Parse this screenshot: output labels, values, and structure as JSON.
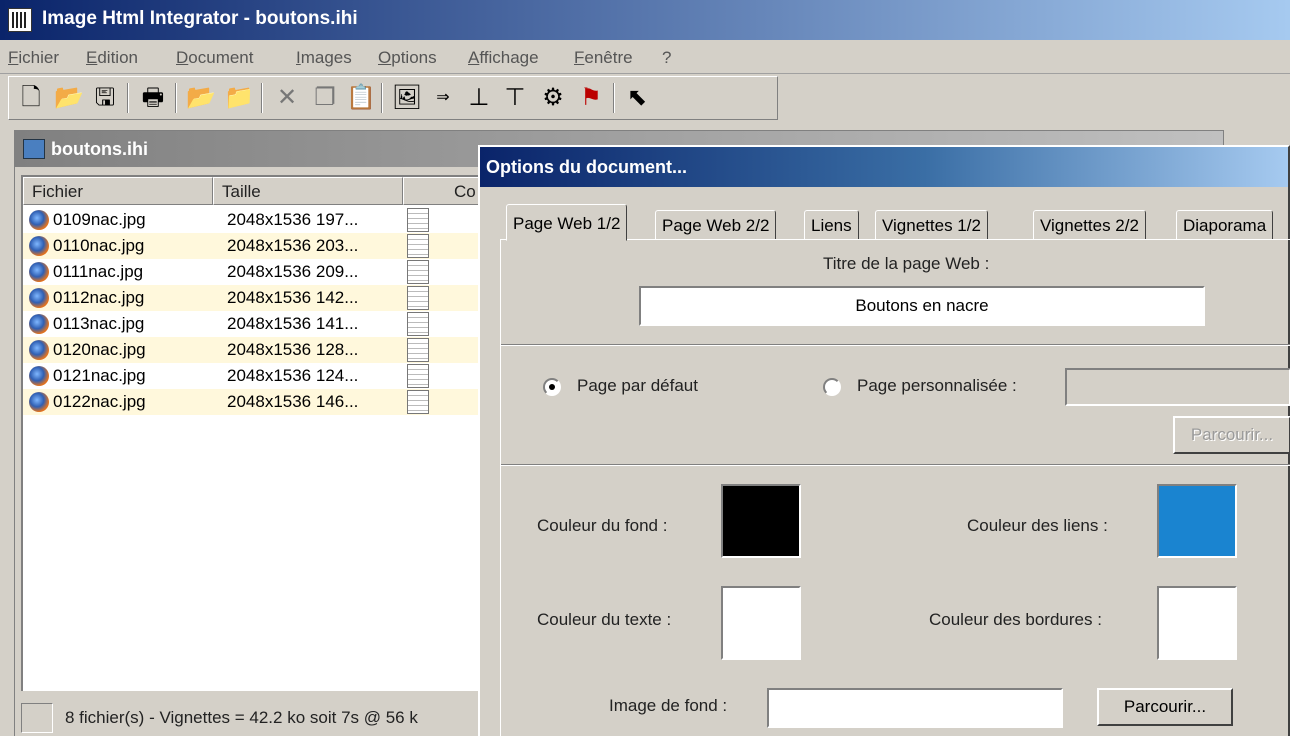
{
  "window": {
    "title": "Image Html Integrator - boutons.ihi"
  },
  "menu": [
    "Fichier",
    "Edition",
    "Document",
    "Images",
    "Options",
    "Affichage",
    "Fenêtre",
    "?"
  ],
  "toolbar": {
    "icons": [
      "new-file-icon",
      "open-folder-icon",
      "save-icon",
      "print-icon",
      "open-images-icon",
      "folder-new-icon",
      "cut-icon",
      "copy-icon",
      "paste-icon",
      "insert-image-icon",
      "move-image-icon",
      "move-up-icon",
      "move-down-icon",
      "generate-icon",
      "publish-web-icon",
      "back-icon"
    ]
  },
  "child_window": {
    "title": "boutons.ihi",
    "columns": [
      "Fichier",
      "Taille",
      "Co"
    ],
    "files": [
      {
        "name": "0109nac.jpg",
        "size": "2048x1536  197..."
      },
      {
        "name": "0110nac.jpg",
        "size": "2048x1536  203..."
      },
      {
        "name": "0111nac.jpg",
        "size": "2048x1536  209..."
      },
      {
        "name": "0112nac.jpg",
        "size": "2048x1536  142..."
      },
      {
        "name": "0113nac.jpg",
        "size": "2048x1536  141..."
      },
      {
        "name": "0120nac.jpg",
        "size": "2048x1536  128..."
      },
      {
        "name": "0121nac.jpg",
        "size": "2048x1536  124..."
      },
      {
        "name": "0122nac.jpg",
        "size": "2048x1536  146..."
      }
    ],
    "status": "8 fichier(s) - Vignettes = 42.2 ko soit 7s @ 56 k"
  },
  "dialog": {
    "title": "Options du document...",
    "tabs": [
      "Page Web 1/2",
      "Page Web 2/2",
      "Liens",
      "Vignettes 1/2",
      "Vignettes 2/2",
      "Diaporama"
    ],
    "active_tab": "Page Web 1/2",
    "web_title_label": "Titre de la page Web :",
    "web_title_value": "Boutons en nacre",
    "radio_default": "Page par défaut",
    "radio_custom": "Page personnalisée :",
    "browse_custom": "Parcourir...",
    "bg_color_label": "Couleur du fond :",
    "bg_color": "#000000",
    "link_color_label": "Couleur des liens :",
    "link_color": "#1a84d0",
    "text_color_label": "Couleur du texte :",
    "text_color": "#ffffff",
    "border_color_label": "Couleur des bordures :",
    "border_color": "#ffffff",
    "bg_image_label": "Image de fond :",
    "bg_image_value": "",
    "browse_bg": "Parcourir..."
  }
}
